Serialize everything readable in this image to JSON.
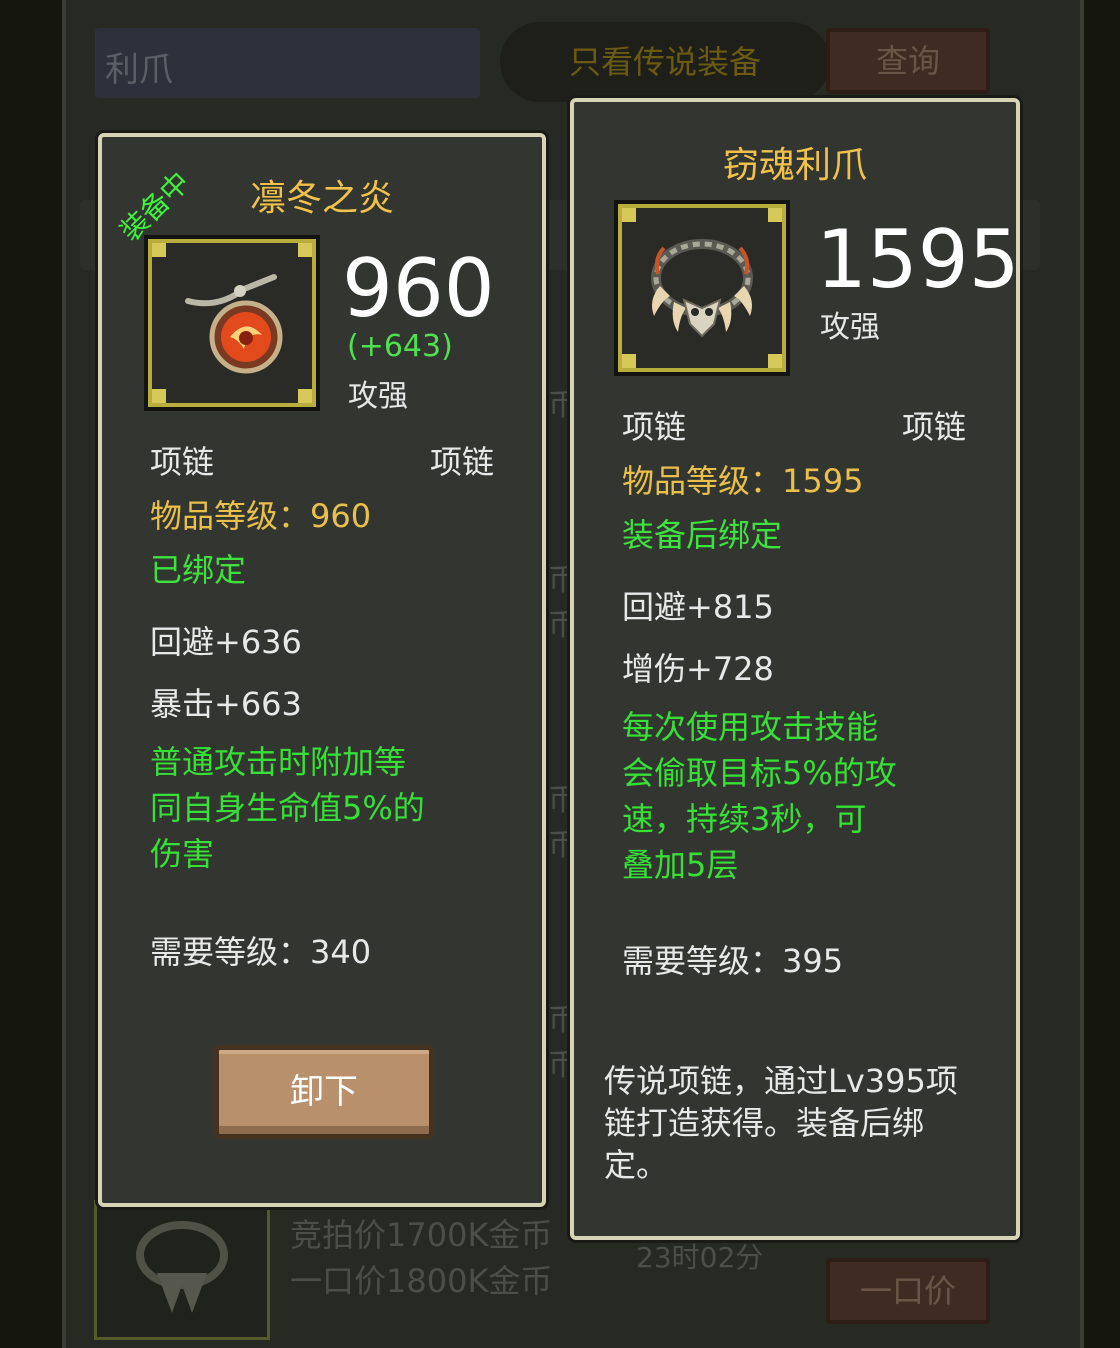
{
  "background": {
    "search_value": "利爪",
    "filter_toggle": "只看传说装备",
    "query_button": "查询",
    "listing": {
      "auction_price": "竞拍价1700K金币",
      "buyout_price": "一口价1800K金币",
      "time_left": "23时02分",
      "buyout_button": "一口价"
    },
    "side_char": "币"
  },
  "equipped_item": {
    "badge": "装备中",
    "name": "凛冬之炎",
    "icon": "fire-amulet-icon",
    "stat_value": "960",
    "stat_diff": "(+643)",
    "stat_label": "攻强",
    "type_left": "项链",
    "type_right": "项链",
    "item_level": "物品等级：960",
    "bind_status": "已绑定",
    "attributes": [
      "回避+636",
      "暴击+663"
    ],
    "effect_lines": [
      "普通攻击时附加等",
      "同自身生命值5%的",
      "伤害"
    ],
    "required_level": "需要等级：340",
    "action_button": "卸下"
  },
  "compare_item": {
    "name": "窃魂利爪",
    "icon": "claw-necklace-icon",
    "stat_value": "1595",
    "stat_label": "攻强",
    "type_left": "项链",
    "type_right": "项链",
    "item_level": "物品等级：1595",
    "bind_status": "装备后绑定",
    "attributes": [
      "回避+815",
      "增伤+728"
    ],
    "effect_lines": [
      "每次使用攻击技能",
      "会偷取目标5%的攻",
      "速，持续3秒，可",
      "叠加5层"
    ],
    "required_level": "需要等级：395",
    "lore_lines": [
      "传说项链，通过Lv395项",
      "链打造获得。装备后绑",
      "定。"
    ]
  },
  "colors": {
    "name": "#f0c24a",
    "item_level": "#e8c04a",
    "green_text": "#3ee23e",
    "card_border": "#d7d4b6",
    "card_bg": "#333630"
  }
}
